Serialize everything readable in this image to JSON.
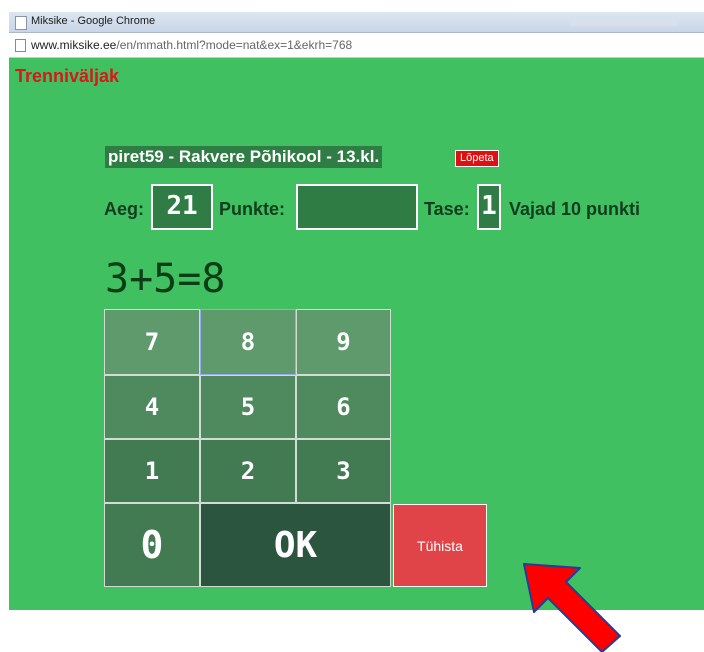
{
  "browser": {
    "window_title": "Miksike - Google Chrome",
    "url_domain": "www.miksike.ee",
    "url_path": "/en/mmath.html?mode=nat&ex=1&ekrh=768"
  },
  "page": {
    "site_title": "Trenniväljak",
    "user_info": "piret59 - Rakvere Põhikool - 13.kl.",
    "stop_label": "Lõpeta",
    "time_label": "Aeg:",
    "time_value": "21",
    "points_label": "Punkte:",
    "points_value": "",
    "level_label": "Tase:",
    "level_value": "1",
    "needed_text": "Vajad 10 punkti",
    "equation": "3+5=8"
  },
  "keypad": {
    "k7": "7",
    "k8": "8",
    "k9": "9",
    "k4": "4",
    "k5": "5",
    "k6": "6",
    "k1": "1",
    "k2": "2",
    "k3": "3",
    "k0": "0",
    "ok": "OK",
    "cancel": "Tühista"
  },
  "colors": {
    "background": "#41c061",
    "site_title": "#d6191b",
    "arrow": "#ff0000",
    "arrow_outline": "#1f3f9a"
  },
  "icons": {
    "arrow": "red-pointer-arrow-icon"
  }
}
